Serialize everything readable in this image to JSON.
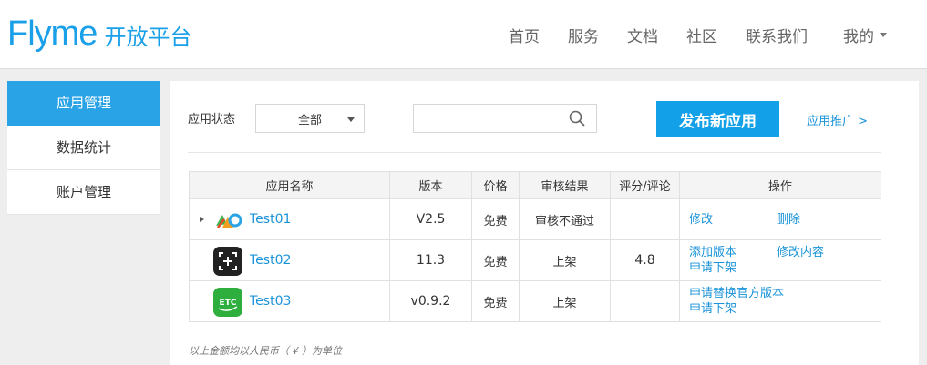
{
  "header": {
    "logo_word": "Flyme",
    "logo_sub": "开放平台",
    "nav": [
      "首页",
      "服务",
      "文档",
      "社区",
      "联系我们"
    ],
    "me_label": "我的"
  },
  "sidebar": {
    "items": [
      {
        "label": "应用管理",
        "active": true
      },
      {
        "label": "数据统计",
        "active": false
      },
      {
        "label": "账户管理",
        "active": false
      }
    ]
  },
  "toolbar": {
    "status_label": "应用状态",
    "status_selected": "全部",
    "search_value": "",
    "publish_label": "发布新应用",
    "promo_label": "应用推广 >"
  },
  "table": {
    "headers": [
      "应用名称",
      "版本",
      "价格",
      "审核结果",
      "评分/评论",
      "操作"
    ],
    "rows": [
      {
        "name": "Test01",
        "version": "V2.5",
        "price": "免费",
        "review": "审核不通过",
        "score": "",
        "ops": [
          "修改",
          "删除"
        ]
      },
      {
        "name": "Test02",
        "version": "11.3",
        "price": "免费",
        "review": "上架",
        "score": "4.8",
        "ops": [
          "添加版本",
          "修改内容",
          "申请下架"
        ]
      },
      {
        "name": "Test03",
        "version": "v0.9.2",
        "price": "免费",
        "review": "上架",
        "score": "",
        "ops": [
          "申请替换官方版本",
          "申请下架"
        ]
      }
    ],
    "icon3_text": "ETC"
  },
  "footer_note": "以上金额均以人民币（ ¥ ）为单位",
  "colors": {
    "accent": "#12a0e8",
    "link": "#1a93d8",
    "fail": "#e8742a",
    "ok": "#3a9a23"
  }
}
